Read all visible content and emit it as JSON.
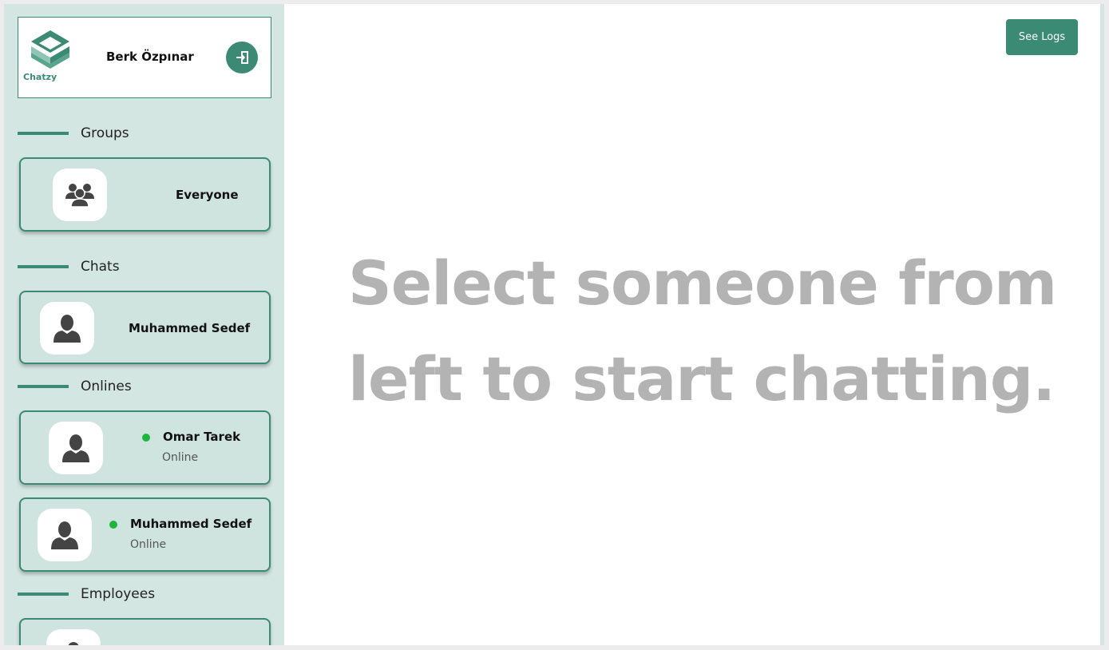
{
  "app": {
    "logo_text": "Chatzy",
    "user_name": "Berk Özpınar"
  },
  "sections": {
    "groups": "Groups",
    "chats": "Chats",
    "onlines": "Onlines",
    "employees": "Employees"
  },
  "groups": [
    {
      "name": "Everyone"
    }
  ],
  "chats": [
    {
      "name": "Muhammed Sedef"
    }
  ],
  "onlines": [
    {
      "name": "Omar Tarek",
      "status": "Online"
    },
    {
      "name": "Muhammed Sedef",
      "status": "Online"
    }
  ],
  "main": {
    "logs_button": "See Logs",
    "placeholder_line1": "Select someone from",
    "placeholder_line2": "left to start chatting."
  },
  "colors": {
    "accent": "#3a8a74",
    "sidebar_bg": "#d4e6e1",
    "card_bg": "#cfe4de",
    "online": "#1db53a",
    "placeholder_text": "#b3b3b3"
  }
}
